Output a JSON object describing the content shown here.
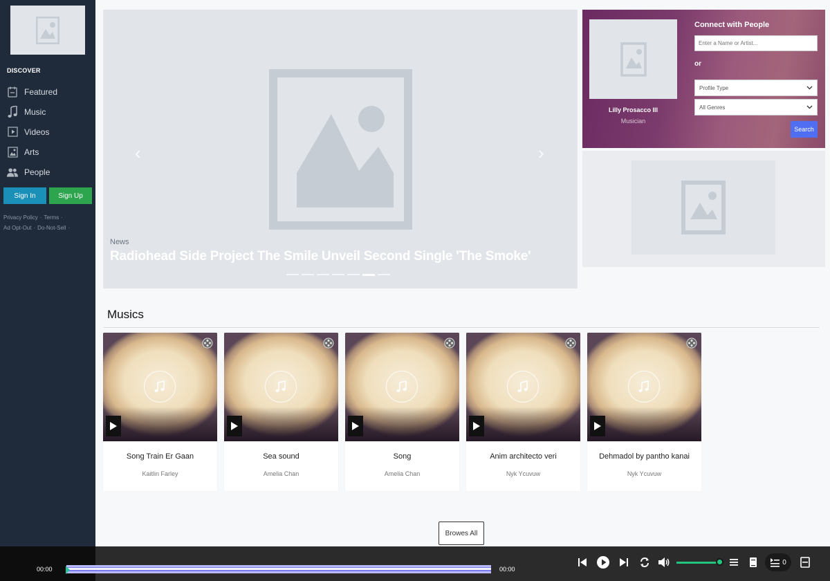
{
  "sidebar": {
    "section_label": "DISCOVER",
    "items": [
      {
        "label": "Featured",
        "icon": "calendar-icon"
      },
      {
        "label": "Music",
        "icon": "music-note-icon"
      },
      {
        "label": "Videos",
        "icon": "video-icon"
      },
      {
        "label": "Arts",
        "icon": "image-icon"
      },
      {
        "label": "People",
        "icon": "people-icon"
      }
    ],
    "sign_in": "Sign In",
    "sign_up": "Sign Up",
    "links": [
      "Privacy Policy",
      "Terms",
      "Ad Opt-Out",
      "Do-Not-Sell"
    ]
  },
  "hero": {
    "category": "News",
    "title": "Radiohead Side Project The Smile Unveil Second Single 'The Smoke'",
    "slide_count": 7,
    "active_slide": 6
  },
  "connect": {
    "title": "Connect with People",
    "search_placeholder": "Enter a Name or Artist...",
    "or_text": "or",
    "profile_type": "Profile Type",
    "genres": "All Genres",
    "search_button": "Search",
    "featured_profile": {
      "name": "Lilly Prosacco III",
      "role": "Musician"
    }
  },
  "musics": {
    "title": "Musics",
    "items": [
      {
        "title": "Song Train Er Gaan",
        "artist": "Kaitlin Farley"
      },
      {
        "title": "Sea sound",
        "artist": "Amelia Chan"
      },
      {
        "title": "Song",
        "artist": "Amelia Chan"
      },
      {
        "title": "Anim architecto veri",
        "artist": "Nyk Ycuvuw"
      },
      {
        "title": "Dehmadol by pantho kanai",
        "artist": "Nyk Ycuvuw"
      }
    ],
    "browse_button": "Browes All"
  },
  "player": {
    "time_current": "00:00",
    "time_total": "00:00",
    "queue_count": "0",
    "accent_color": "#7b7bf0",
    "volume_color": "#22c57f"
  }
}
